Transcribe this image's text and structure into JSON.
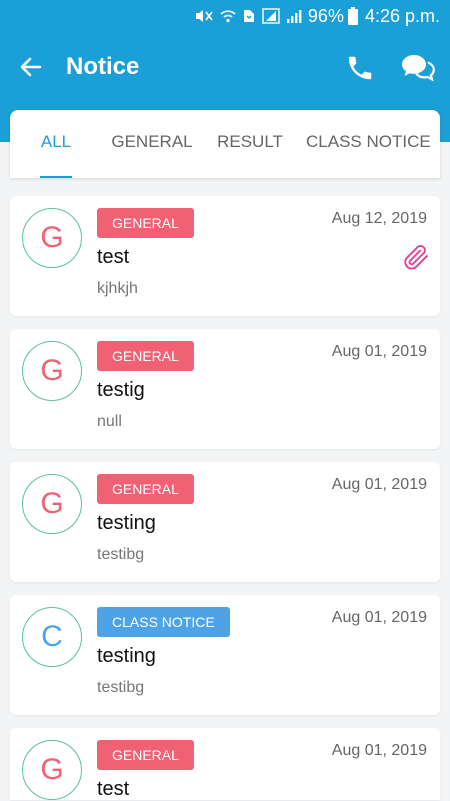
{
  "status_bar": {
    "battery": "96%",
    "time": "4:26 p.m.",
    "icons": [
      "mute-icon",
      "wifi-icon",
      "data-icon",
      "sim-signal-icon",
      "signal-icon",
      "battery-icon"
    ]
  },
  "header": {
    "title": "Notice",
    "back_icon": "back-arrow-icon",
    "actions": [
      "phone-icon",
      "chat-icon"
    ],
    "color": "#1aa0d7"
  },
  "tabs": [
    {
      "label": "ALL",
      "active": true
    },
    {
      "label": "GENERAL",
      "active": false
    },
    {
      "label": "RESULT",
      "active": false
    },
    {
      "label": "CLASS NOTICE",
      "active": false
    }
  ],
  "colors": {
    "general_badge": "#ef6173",
    "class_notice_badge": "#4ea3e6",
    "avatar_border": "#5cbfa4",
    "attachment": "#e83e8c"
  },
  "notices": [
    {
      "initial": "G",
      "category": "GENERAL",
      "date": "Aug 12, 2019",
      "title": "test",
      "subtitle": "kjhkjh",
      "attachment": true
    },
    {
      "initial": "G",
      "category": "GENERAL",
      "date": "Aug 01, 2019",
      "title": "testig",
      "subtitle": "null",
      "attachment": false
    },
    {
      "initial": "G",
      "category": "GENERAL",
      "date": "Aug 01, 2019",
      "title": "testing",
      "subtitle": "testibg",
      "attachment": false
    },
    {
      "initial": "C",
      "category": "CLASS NOTICE",
      "date": "Aug 01, 2019",
      "title": "testing",
      "subtitle": "testibg",
      "attachment": false
    },
    {
      "initial": "G",
      "category": "GENERAL",
      "date": "Aug 01, 2019",
      "title": "test",
      "subtitle": "",
      "attachment": false
    }
  ]
}
